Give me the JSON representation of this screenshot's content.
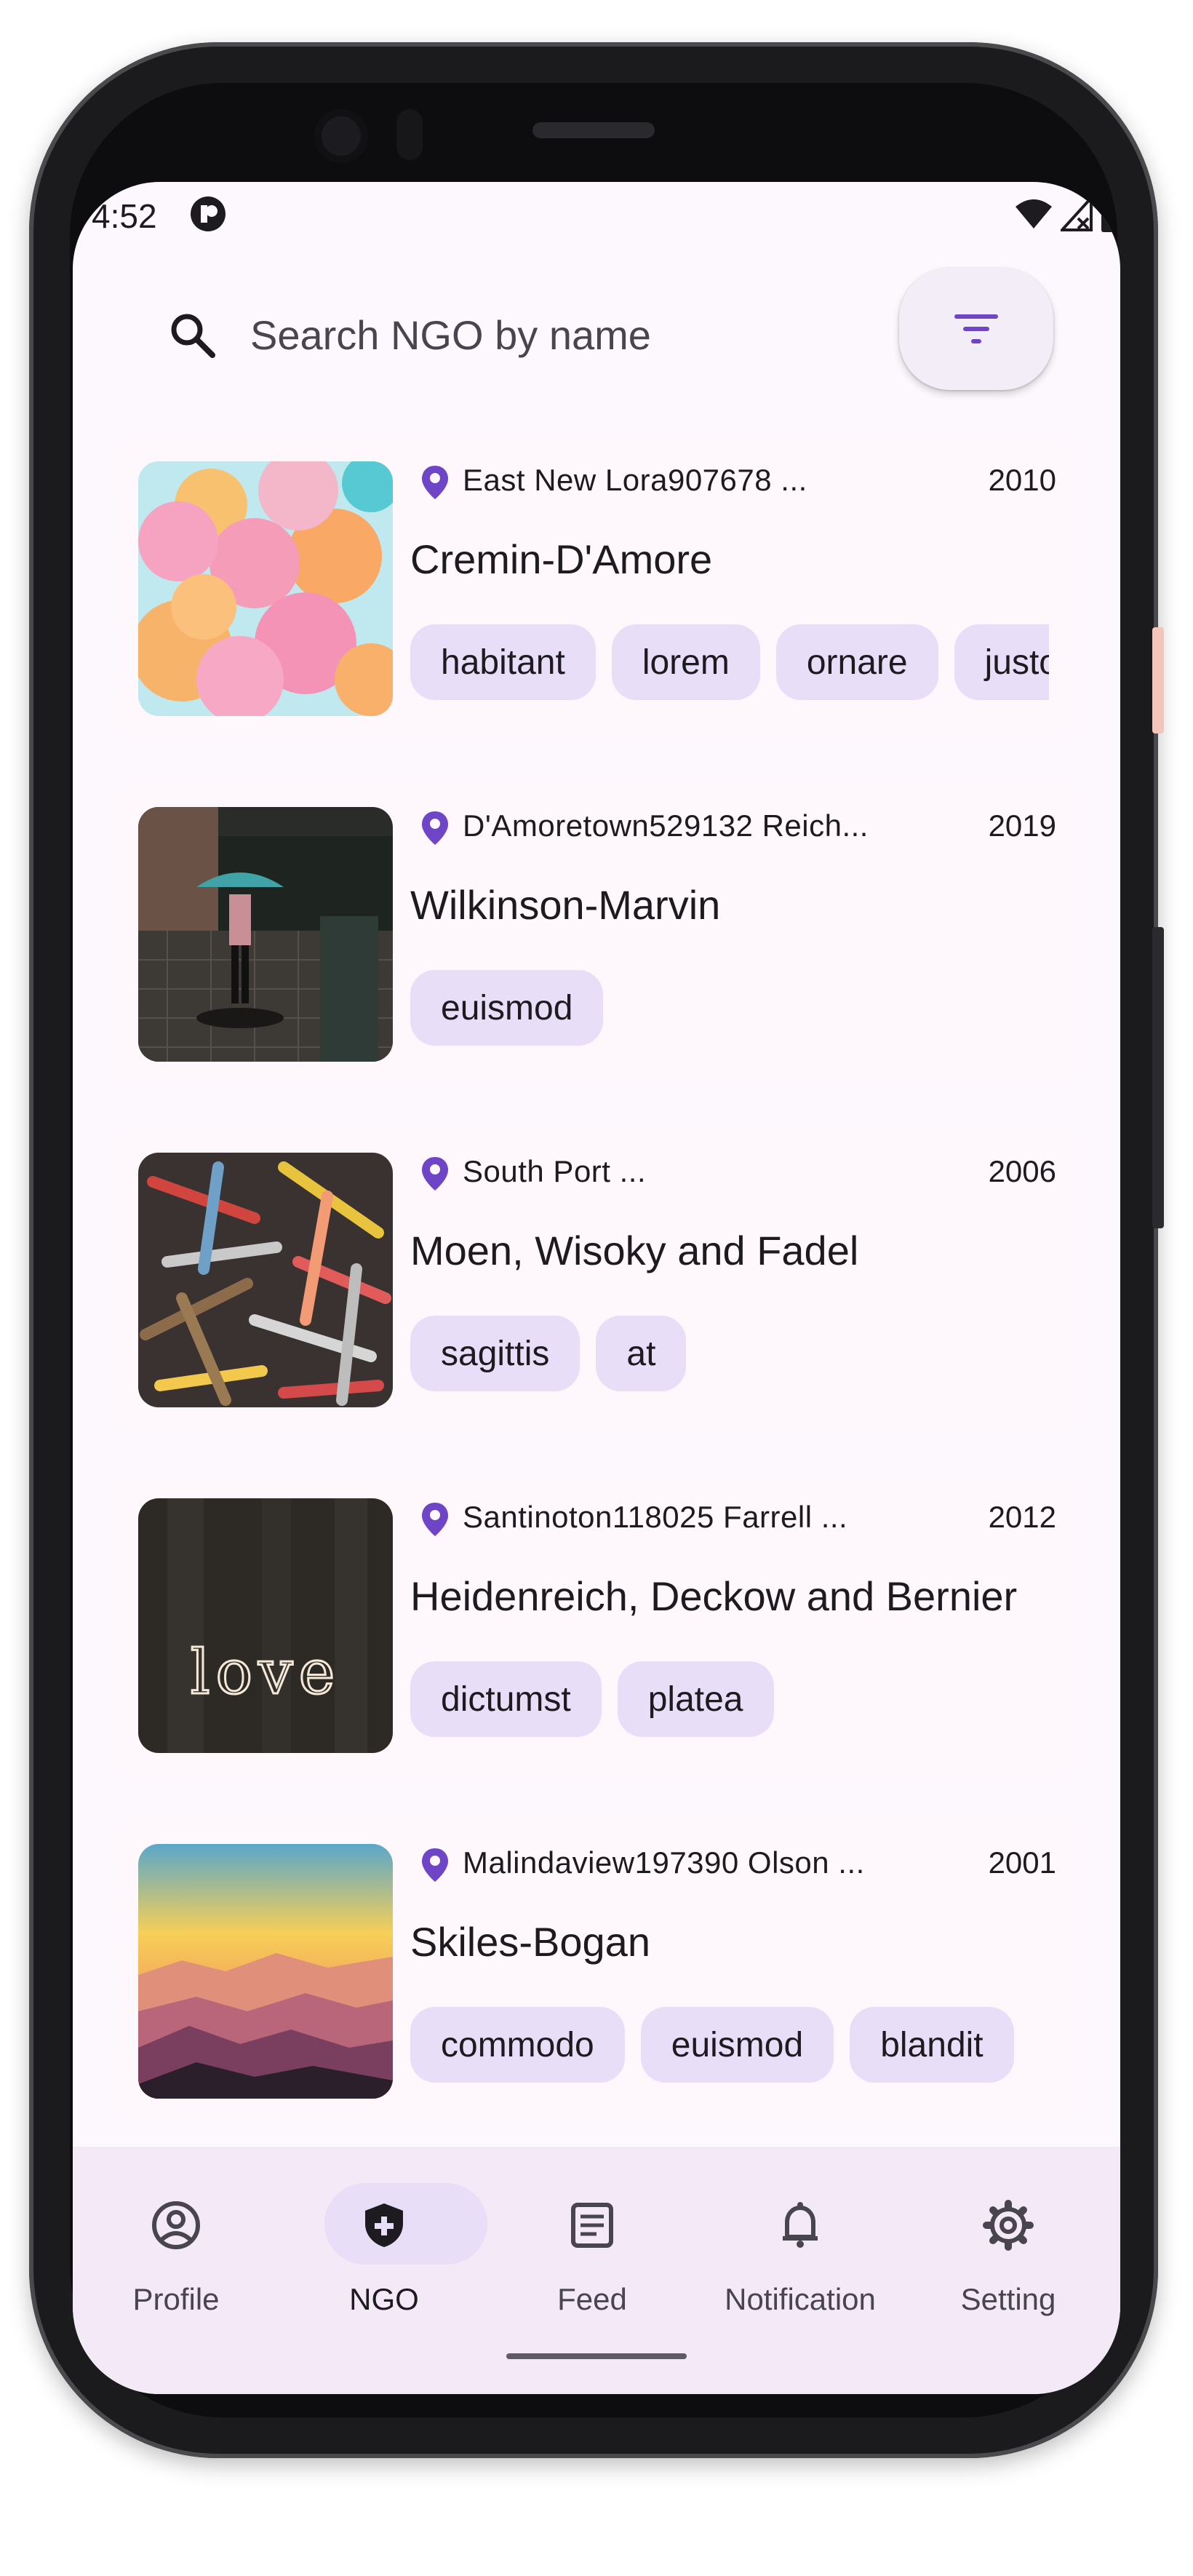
{
  "status_bar": {
    "time": "4:52"
  },
  "search": {
    "placeholder": "Search NGO by name",
    "value": ""
  },
  "ngos": [
    {
      "location": "East New Lora907678 ...",
      "year": "2010",
      "name": "Cremin-D'Amore",
      "tags": [
        "habitant",
        "lorem",
        "ornare",
        "justo"
      ]
    },
    {
      "location": "D'Amoretown529132 Reich...",
      "year": "2019",
      "name": "Wilkinson-Marvin",
      "tags": [
        "euismod"
      ]
    },
    {
      "location": "South Port ...",
      "year": "2006",
      "name": "Moen, Wisoky and Fadel",
      "tags": [
        "sagittis",
        "at"
      ]
    },
    {
      "location": "Santinoton118025 Farrell ...",
      "year": "2012",
      "name": "Heidenreich, Deckow and Bernier",
      "tags": [
        "dictumst",
        "platea"
      ]
    },
    {
      "location": "Malindaview197390 Olson ...",
      "year": "2001",
      "name": "Skiles-Bogan",
      "tags": [
        "commodo",
        "euismod",
        "blandit"
      ]
    }
  ],
  "nav": {
    "items": [
      {
        "label": "Profile",
        "icon": "account-circle-icon"
      },
      {
        "label": "NGO",
        "icon": "shield-plus-icon",
        "selected": true
      },
      {
        "label": "Feed",
        "icon": "article-icon"
      },
      {
        "label": "Notification",
        "icon": "bell-icon"
      },
      {
        "label": "Setting",
        "icon": "gear-icon"
      }
    ]
  },
  "colors": {
    "accent": "#6f45c7",
    "chip_bg": "#e8def8",
    "nav_bg": "#f3e9f7",
    "card_bg": "#fef7fb"
  }
}
